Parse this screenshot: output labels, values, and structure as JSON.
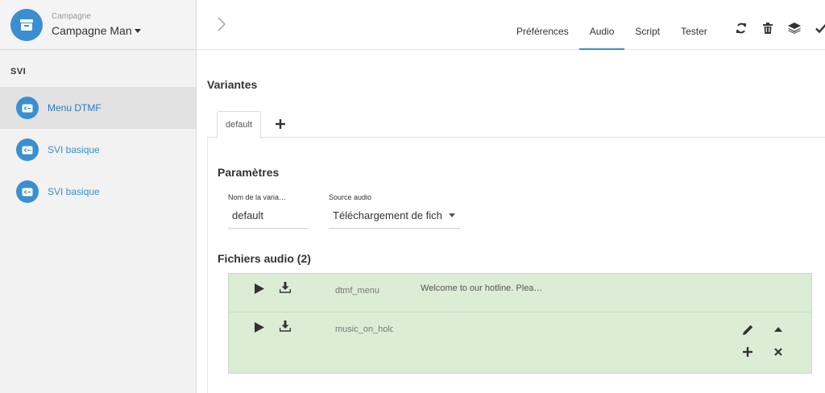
{
  "sidebar": {
    "campaign_caption": "Campagne",
    "campaign_name": "Campagne Man",
    "section_title": "SVI",
    "items": [
      {
        "label": "Menu DTMF",
        "active": true
      },
      {
        "label": "SVI basique",
        "active": false
      },
      {
        "label": "SVI basique",
        "active": false
      }
    ]
  },
  "topbar": {
    "tabs": [
      {
        "label": "Préférences",
        "active": false
      },
      {
        "label": "Audio",
        "active": true
      },
      {
        "label": "Script",
        "active": false
      },
      {
        "label": "Tester",
        "active": false
      }
    ],
    "actions": [
      "refresh-icon",
      "trash-icon",
      "layers-icon",
      "check-icon"
    ]
  },
  "main": {
    "variantes_title": "Variantes",
    "variant_tabs": [
      {
        "label": "default"
      }
    ],
    "params_title": "Paramètres",
    "fields": {
      "variant_name_label": "Nom de la varia…",
      "variant_name_value": "default",
      "audio_source_label": "Source audio",
      "audio_source_value": "Téléchargement de fich"
    },
    "files_title": "Fichiers audio (2)",
    "files": [
      {
        "name": "dtmf_menu",
        "text": "Welcome to our hotline. Plea…"
      },
      {
        "name": "music_on_hold",
        "text": ""
      }
    ]
  },
  "colors": {
    "accent": "#3a8fd0",
    "file_row_bg": "#dcedd6",
    "sidebar_bg": "#f2f2f2"
  }
}
